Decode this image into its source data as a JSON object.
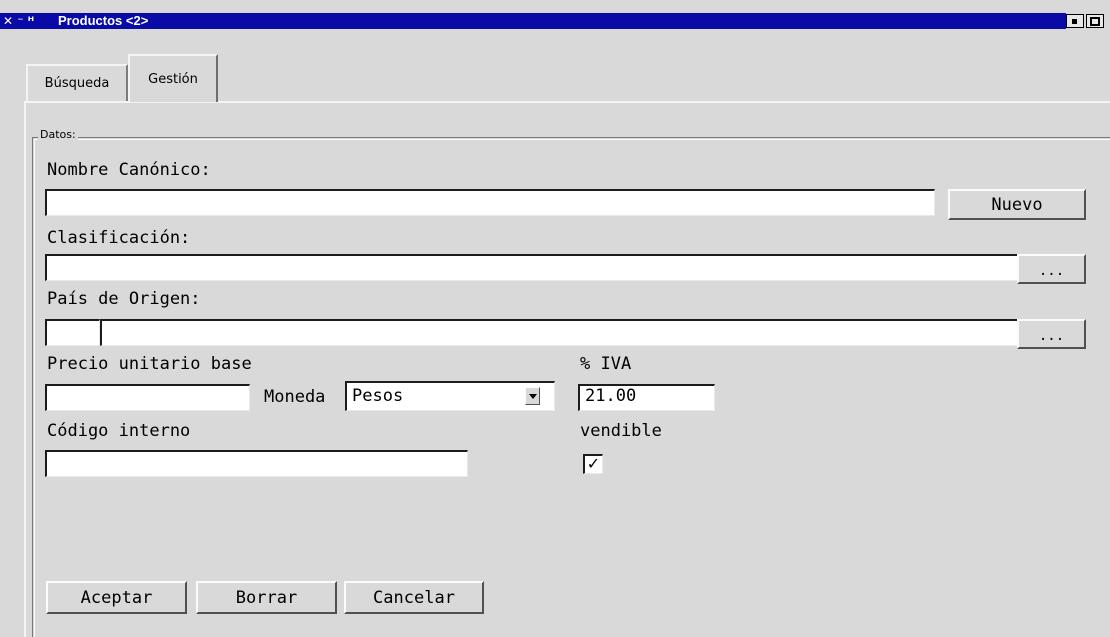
{
  "window": {
    "title": "Productos <2>"
  },
  "tabs": [
    {
      "label": "Búsqueda",
      "active": false
    },
    {
      "label": "Gestión",
      "active": true
    }
  ],
  "group": {
    "legend": "Datos"
  },
  "form": {
    "nombre_label": "Nombre Canónico:",
    "nombre_value": "",
    "nuevo_label": "Nuevo",
    "clasificacion_label": "Clasificación:",
    "clasificacion_value": "",
    "clasificacion_browse": "...",
    "pais_label": "País de Origen:",
    "pais_code": "",
    "pais_name": "",
    "pais_browse": "...",
    "precio_label": "Precio unitario base",
    "precio_value": "",
    "moneda_label": "Moneda",
    "moneda_value": "Pesos",
    "iva_label": "% IVA",
    "iva_value": "21.00",
    "codigo_label": "Código interno",
    "codigo_value": "",
    "vendible_label": "vendible",
    "vendible_checked": true,
    "vendible_mark": "✓"
  },
  "actions": {
    "aceptar": "Aceptar",
    "borrar": "Borrar",
    "cancelar": "Cancelar"
  },
  "icons": {
    "window_menu": "close-x-icon",
    "minimize": "minimize-icon",
    "maximize": "maximize-icon"
  },
  "colors": {
    "title_bar": "#0a0aa6",
    "background": "#d9d9d9"
  }
}
